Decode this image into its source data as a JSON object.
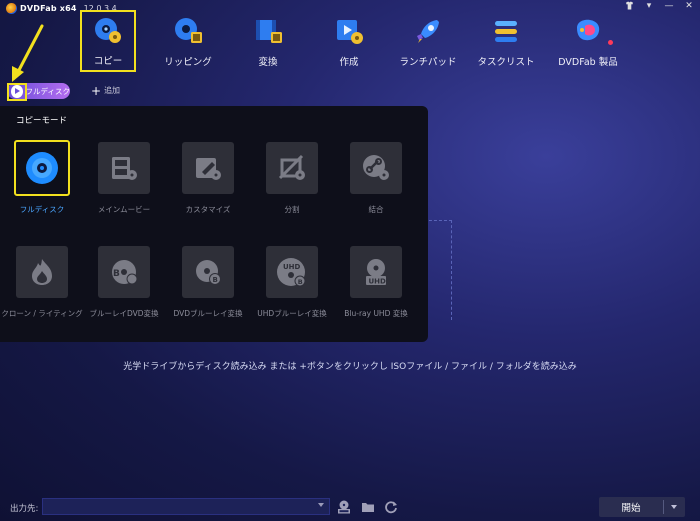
{
  "app": {
    "name": "DVDFab x64",
    "version": "12.0.3.4"
  },
  "window_controls": {
    "shirt_icon": "shirt-icon",
    "menu": "▾",
    "minimize": "—",
    "close": "✕"
  },
  "toolbar": {
    "items": [
      {
        "label": "コピー",
        "icon": "copy-disc-icon",
        "active": true
      },
      {
        "label": "リッピング",
        "icon": "ripping-icon",
        "active": false
      },
      {
        "label": "変換",
        "icon": "convert-icon",
        "active": false
      },
      {
        "label": "作成",
        "icon": "create-icon",
        "active": false
      },
      {
        "label": "ランチパッド",
        "icon": "rocket-icon",
        "active": false
      },
      {
        "label": "タスクリスト",
        "icon": "tasklist-icon",
        "active": false
      },
      {
        "label": "DVDFab 製品",
        "icon": "products-icon",
        "active": false
      }
    ]
  },
  "mode_chip": {
    "label": "フルディスク",
    "icon": "play-circle-icon"
  },
  "add_button": {
    "label": "追加",
    "icon": "plus-icon"
  },
  "copy_mode_panel": {
    "title": "コピーモード",
    "modes": [
      {
        "label": "フルディスク",
        "icon": "full-disc-icon",
        "active": true
      },
      {
        "label": "メインムービー",
        "icon": "main-movie-icon",
        "active": false
      },
      {
        "label": "カスタマイズ",
        "icon": "customize-icon",
        "active": false
      },
      {
        "label": "分割",
        "icon": "split-icon",
        "active": false
      },
      {
        "label": "結合",
        "icon": "merge-icon",
        "active": false
      },
      {
        "label": "クローン / ライティング",
        "icon": "clone-burn-icon",
        "active": false
      },
      {
        "label": "ブルーレイDVD変換",
        "icon": "bluray-to-dvd-icon",
        "active": false
      },
      {
        "label": "DVDブルーレイ変換",
        "icon": "dvd-to-bluray-icon",
        "active": false
      },
      {
        "label": "UHDブルーレイ変換",
        "icon": "uhd-to-bluray-icon",
        "active": false
      },
      {
        "label": "Blu-ray UHD 変換",
        "icon": "bluray-to-uhd-icon",
        "active": false
      }
    ]
  },
  "hint": "光学ドライブからディスク読み込み または +ボタンをクリックし ISOファイル / ファイル / フォルダを読み込み",
  "bottom": {
    "output_label": "出力先:",
    "output_value": "",
    "start_label": "開始"
  },
  "colors": {
    "highlight": "#f2e01e",
    "accent_blue": "#4ba6ff",
    "chip_gradient_start": "#6b4ed8",
    "chip_gradient_end": "#b36df0"
  }
}
